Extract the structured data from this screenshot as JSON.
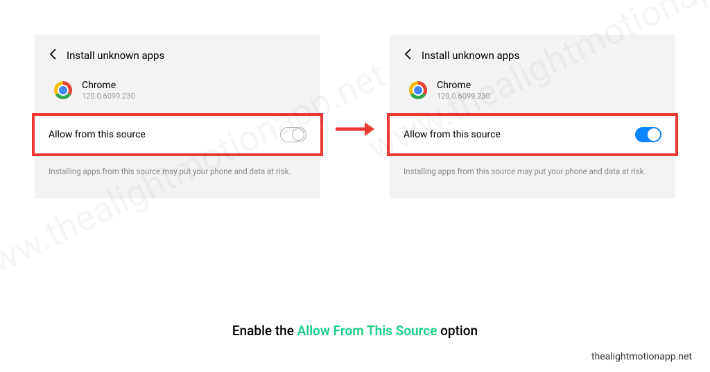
{
  "page_title": "Install unknown apps",
  "app": {
    "name": "Chrome",
    "version": "120.0.6099.230"
  },
  "toggle": {
    "label": "Allow from this source"
  },
  "warning_text": "Installing apps from this source may put your phone and data at risk.",
  "caption": {
    "prefix": "Enable the ",
    "highlight": "Allow From This Source",
    "suffix": " option"
  },
  "credit": "thealightmotionapp.net",
  "watermark": "www.thealightmotionapp.net"
}
